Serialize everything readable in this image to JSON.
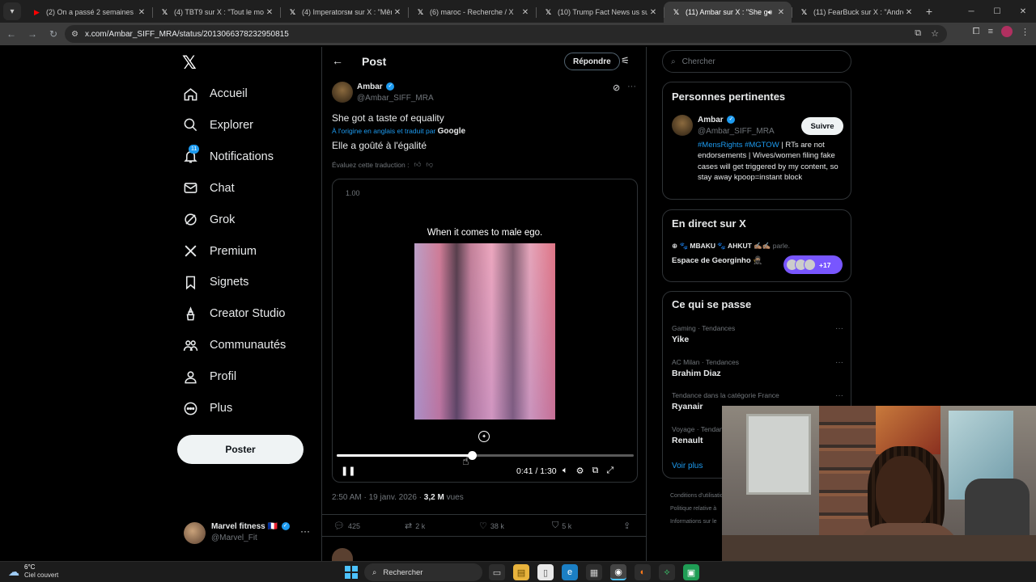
{
  "browser": {
    "tabs": [
      {
        "title": "(2) On a passé 2 semaines avec",
        "icon": "youtube-icon",
        "color": "#ff0000"
      },
      {
        "title": "(4) TBT9 sur X : \"Tout le monde",
        "icon": "x-icon",
        "color": "#ffffff"
      },
      {
        "title": "(4) Imperatorsм sur X : \"Même",
        "icon": "x-icon",
        "color": "#ffffff"
      },
      {
        "title": "(6) maroc - Recherche / X",
        "icon": "x-icon",
        "color": "#ffffff"
      },
      {
        "title": "(10) Trump Fact News us sur X",
        "icon": "x-icon",
        "color": "#ffffff"
      },
      {
        "title": "(11) Ambar sur X : \"She got",
        "icon": "x-icon",
        "color": "#ffffff",
        "active": true
      },
      {
        "title": "(11) FearBuck sur X : \"Andrew",
        "icon": "x-icon",
        "color": "#ffffff"
      }
    ],
    "url": "x.com/Ambar_SIFF_MRA/status/2013066378232950815"
  },
  "nav": {
    "items": [
      {
        "label": "Accueil",
        "icon": "home-icon"
      },
      {
        "label": "Explorer",
        "icon": "search-icon"
      },
      {
        "label": "Notifications",
        "icon": "bell-icon",
        "badge": "11"
      },
      {
        "label": "Chat",
        "icon": "mail-icon"
      },
      {
        "label": "Grok",
        "icon": "grok-icon"
      },
      {
        "label": "Premium",
        "icon": "x-premium-icon"
      },
      {
        "label": "Signets",
        "icon": "bookmark-icon"
      },
      {
        "label": "Creator Studio",
        "icon": "creator-studio-icon"
      },
      {
        "label": "Communautés",
        "icon": "communities-icon"
      },
      {
        "label": "Profil",
        "icon": "person-icon"
      },
      {
        "label": "Plus",
        "icon": "more-circle-icon"
      }
    ],
    "post_button": "Poster",
    "account": {
      "name": "Marvel fitness 🇫🇷",
      "handle": "@Marvel_Fit"
    }
  },
  "post": {
    "header_title": "Post",
    "reply_button": "Répondre",
    "author": {
      "name": "Ambar",
      "handle": "@Ambar_SIFF_MRA"
    },
    "text": "She got a taste of equality",
    "translation_note": "À l'origine en anglais et traduit par",
    "translation_provider": "Google",
    "translated_text": "Elle a goûté à l'égalité",
    "rate_translation": "Évaluez cette traduction :",
    "video": {
      "speed": "1.00",
      "caption": "When it comes to male ego.",
      "time": "0:41 / 1:30",
      "progress": 0.455
    },
    "timestamp": "2:50 AM · 19 janv. 2026 ·",
    "views_count": "3,2 M",
    "views_label": "vues",
    "stats": {
      "replies": "425",
      "reposts": "2 k",
      "likes": "38 k",
      "bookmarks": "5 k"
    }
  },
  "sidebar": {
    "search_placeholder": "Chercher",
    "relevant": {
      "title": "Personnes pertinentes",
      "name": "Ambar",
      "handle": "@Ambar_SIFF_MRA",
      "follow": "Suivre",
      "bio_tags": "#MensRights #MGTOW",
      "bio_text": " | RTs are not endorsements | Wives/women filing fake cases will get triggered by my content, so stay away kpoop=instant block"
    },
    "live": {
      "title": "En direct sur X",
      "hosts": "🐾 MBAKU 🐾 AHKUT ✍🏽✍🏽",
      "hosts_suffix": "parle.",
      "space": "Espace de Georginho 🥷🏽",
      "count": "+17"
    },
    "trends": {
      "title": "Ce qui se passe",
      "items": [
        {
          "meta": "Gaming · Tendances",
          "name": "Yike"
        },
        {
          "meta": "AC Milan · Tendances",
          "name": "Brahim Diaz"
        },
        {
          "meta": "Tendance dans la catégorie France",
          "name": "Ryanair"
        },
        {
          "meta": "Voyage · Tendances",
          "name": "Renault"
        }
      ],
      "see_more": "Voir plus"
    },
    "footer": [
      "Conditions d'utilisation",
      "Politique relative à",
      "Informations sur le"
    ]
  },
  "taskbar": {
    "temp": "6°C",
    "weather": "Ciel couvert",
    "search": "Rechercher"
  }
}
